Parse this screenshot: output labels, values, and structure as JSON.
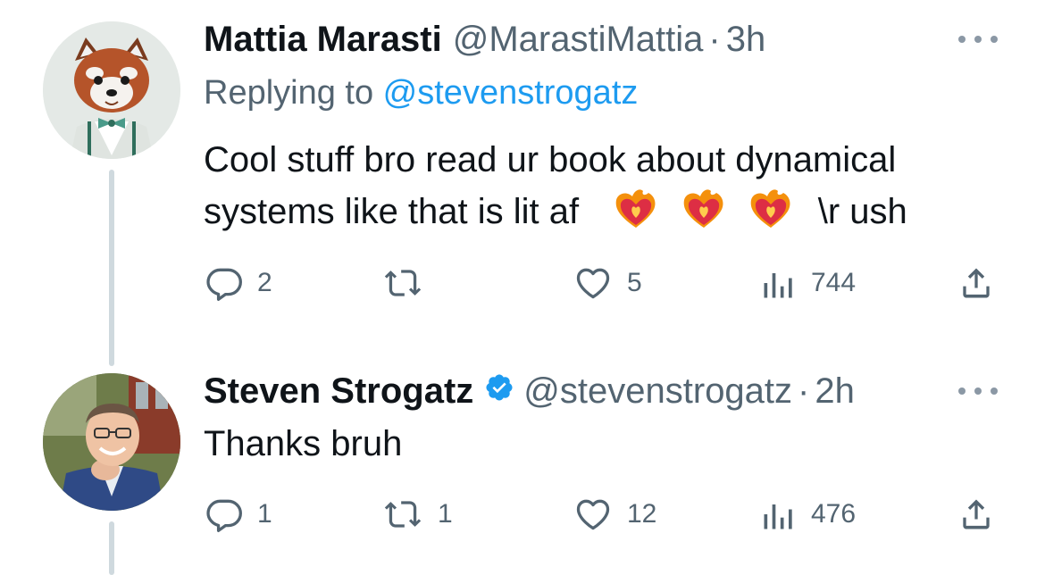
{
  "tweets": [
    {
      "name": "Mattia Marasti",
      "handle": "@MarastiMattia",
      "separator": "·",
      "time": "3h",
      "replying_prefix": "Replying to ",
      "replying_to": "@stevenstrogatz",
      "text_line1": "Cool stuff bro read ur book about dynamical",
      "text_line2": "systems like that is lit af",
      "emoji_icons": [
        "heart-on-fire-icon",
        "heart-on-fire-icon",
        "heart-on-fire-icon"
      ],
      "text_tail": "\\r ush",
      "replies": "2",
      "retweets": "",
      "likes": "5",
      "views": "744",
      "verified": false
    },
    {
      "name": "Steven Strogatz",
      "handle": "@stevenstrogatz",
      "separator": "·",
      "time": "2h",
      "text_line1": "Thanks bruh",
      "replies": "1",
      "retweets": "1",
      "likes": "12",
      "views": "476",
      "verified": true
    }
  ],
  "colors": {
    "text": "#0f1419",
    "secondary": "#536471",
    "link": "#1d9bf0",
    "thread_line": "#cfd9de",
    "verified_badge": "#1d9bf0"
  }
}
